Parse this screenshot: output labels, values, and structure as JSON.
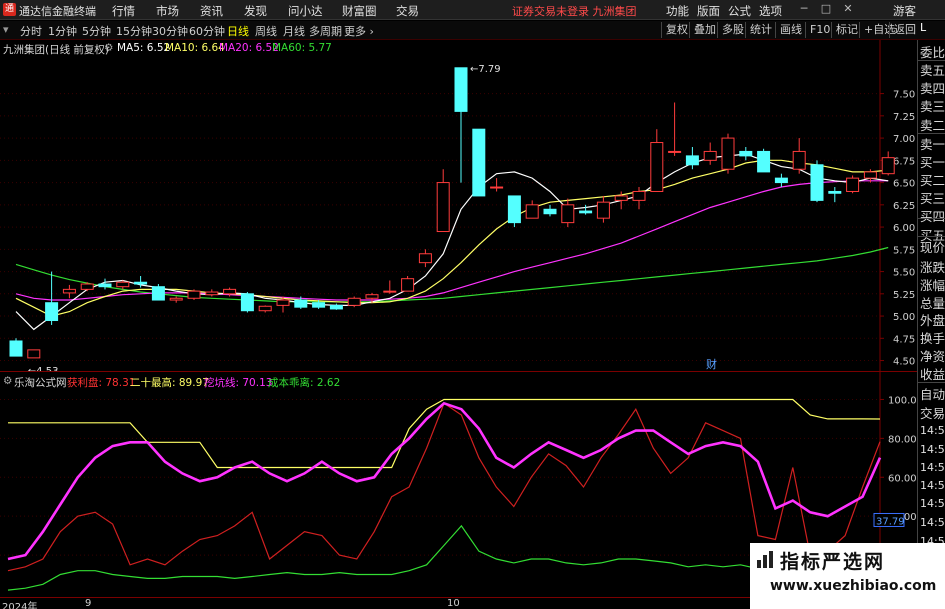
{
  "app": {
    "title": "通达信金融终端",
    "logo_letter": "通",
    "menus": [
      "行情",
      "市场",
      "资讯",
      "发现",
      "问小达",
      "财富圈",
      "交易"
    ],
    "status": "证券交易未登录  九洲集团",
    "right_menus": [
      "功能",
      "版面",
      "公式",
      "选项"
    ],
    "guest": "游客"
  },
  "toolbar": {
    "timeframes": [
      "分时",
      "1分钟",
      "5分钟",
      "15分钟",
      "30分钟",
      "60分钟",
      "日线",
      "周线",
      "月线",
      "多周期",
      "更多"
    ],
    "active_timeframe": "日线",
    "buttons": [
      "复权",
      "叠加",
      "多股",
      "统计",
      "画线",
      "F10",
      "标记",
      "+自选",
      "返回"
    ]
  },
  "main_chart": {
    "title": "九洲集团(日线 前复权)",
    "ma_labels": [
      {
        "text": "MA5: 6.52",
        "color": "#ffffff"
      },
      {
        "text": "MA10: 6.64",
        "color": "#ffff66"
      },
      {
        "text": "MA20: 6.52",
        "color": "#ff33ff"
      },
      {
        "text": "MA60: 5.77",
        "color": "#33dd33"
      }
    ],
    "high_label": "7.79",
    "low_label": "4.53",
    "marker": "财",
    "price_ticks": [
      "7.50",
      "7.25",
      "7.00",
      "6.75",
      "6.50",
      "6.25",
      "6.00",
      "5.75",
      "5.50",
      "5.25",
      "5.00",
      "4.75",
      "4.50"
    ]
  },
  "sub_chart": {
    "title": "乐淘公式网",
    "labels": [
      {
        "text": "获利盘: 78.31",
        "color": "#ff3333"
      },
      {
        "text": "二十最高: 89.97",
        "color": "#ffff66"
      },
      {
        "text": "挖坑线: 70.13",
        "color": "#ff33ff"
      },
      {
        "text": "成本乖离: 2.62",
        "color": "#33dd33"
      }
    ],
    "ticks": [
      "100.0",
      "80.00",
      "60.00",
      "40.00",
      "20.00"
    ],
    "current_value": "37.79"
  },
  "xaxis": {
    "labels": [
      "2024年",
      "9",
      "10"
    ]
  },
  "side_panel": {
    "items": [
      "委比",
      "卖五",
      "卖四",
      "卖三",
      "卖二",
      "卖一",
      "买一",
      "买二",
      "买三",
      "买四",
      "买五",
      "现价",
      "涨跌",
      "涨幅",
      "总量",
      "外盘",
      "换手",
      "净资",
      "收益",
      "自动",
      "交易",
      "14:56",
      "14:56",
      "14:56",
      "14:56",
      "14:56",
      "14:56",
      "14:56",
      "14:56"
    ],
    "top_letter": "L"
  },
  "watermark": {
    "title": "指标严选网",
    "url": "www.xuezhibiao.com"
  },
  "chart_data": {
    "type": "candlestick",
    "price_range": [
      4.45,
      7.9
    ],
    "candles": [
      {
        "o": 4.72,
        "h": 4.75,
        "l": 4.55,
        "c": 4.55
      },
      {
        "o": 4.53,
        "h": 4.62,
        "l": 4.53,
        "c": 4.62
      },
      {
        "o": 5.15,
        "h": 5.5,
        "l": 4.9,
        "c": 4.95
      },
      {
        "o": 5.26,
        "h": 5.35,
        "l": 5.2,
        "c": 5.3
      },
      {
        "o": 5.3,
        "h": 5.38,
        "l": 5.28,
        "c": 5.36
      },
      {
        "o": 5.36,
        "h": 5.42,
        "l": 5.3,
        "c": 5.33
      },
      {
        "o": 5.33,
        "h": 5.4,
        "l": 5.3,
        "c": 5.38
      },
      {
        "o": 5.38,
        "h": 5.45,
        "l": 5.32,
        "c": 5.36
      },
      {
        "o": 5.33,
        "h": 5.36,
        "l": 5.18,
        "c": 5.18
      },
      {
        "o": 5.18,
        "h": 5.22,
        "l": 5.15,
        "c": 5.2
      },
      {
        "o": 5.2,
        "h": 5.3,
        "l": 5.18,
        "c": 5.28
      },
      {
        "o": 5.24,
        "h": 5.3,
        "l": 5.22,
        "c": 5.27
      },
      {
        "o": 5.25,
        "h": 5.32,
        "l": 5.22,
        "c": 5.3
      },
      {
        "o": 5.25,
        "h": 5.27,
        "l": 5.04,
        "c": 5.06
      },
      {
        "o": 5.06,
        "h": 5.12,
        "l": 5.04,
        "c": 5.11
      },
      {
        "o": 5.12,
        "h": 5.22,
        "l": 5.04,
        "c": 5.18
      },
      {
        "o": 5.18,
        "h": 5.22,
        "l": 5.08,
        "c": 5.1
      },
      {
        "o": 5.15,
        "h": 5.18,
        "l": 5.08,
        "c": 5.1
      },
      {
        "o": 5.12,
        "h": 5.14,
        "l": 5.07,
        "c": 5.08
      },
      {
        "o": 5.12,
        "h": 5.22,
        "l": 5.1,
        "c": 5.2
      },
      {
        "o": 5.2,
        "h": 5.26,
        "l": 5.15,
        "c": 5.24
      },
      {
        "o": 5.28,
        "h": 5.4,
        "l": 5.25,
        "c": 5.28
      },
      {
        "o": 5.28,
        "h": 5.45,
        "l": 5.28,
        "c": 5.42
      },
      {
        "o": 5.6,
        "h": 5.75,
        "l": 5.55,
        "c": 5.7
      },
      {
        "o": 5.95,
        "h": 6.65,
        "l": 5.95,
        "c": 6.5
      },
      {
        "o": 7.79,
        "h": 7.79,
        "l": 6.5,
        "c": 7.3
      },
      {
        "o": 7.1,
        "h": 7.1,
        "l": 6.35,
        "c": 6.35
      },
      {
        "o": 6.45,
        "h": 6.55,
        "l": 6.4,
        "c": 6.45
      },
      {
        "o": 6.35,
        "h": 6.35,
        "l": 6.0,
        "c": 6.05
      },
      {
        "o": 6.1,
        "h": 6.3,
        "l": 6.1,
        "c": 6.25
      },
      {
        "o": 6.2,
        "h": 6.25,
        "l": 6.12,
        "c": 6.15
      },
      {
        "o": 6.05,
        "h": 6.32,
        "l": 6.0,
        "c": 6.25
      },
      {
        "o": 6.18,
        "h": 6.25,
        "l": 6.14,
        "c": 6.16
      },
      {
        "o": 6.1,
        "h": 6.35,
        "l": 6.05,
        "c": 6.28
      },
      {
        "o": 6.3,
        "h": 6.4,
        "l": 6.2,
        "c": 6.35
      },
      {
        "o": 6.3,
        "h": 6.45,
        "l": 6.2,
        "c": 6.4
      },
      {
        "o": 6.4,
        "h": 7.1,
        "l": 6.4,
        "c": 6.95
      },
      {
        "o": 6.85,
        "h": 7.4,
        "l": 6.8,
        "c": 6.85
      },
      {
        "o": 6.8,
        "h": 6.9,
        "l": 6.65,
        "c": 6.7
      },
      {
        "o": 6.75,
        "h": 6.95,
        "l": 6.7,
        "c": 6.85
      },
      {
        "o": 6.65,
        "h": 7.05,
        "l": 6.6,
        "c": 7.0
      },
      {
        "o": 6.85,
        "h": 6.9,
        "l": 6.75,
        "c": 6.8
      },
      {
        "o": 6.85,
        "h": 6.88,
        "l": 6.62,
        "c": 6.62
      },
      {
        "o": 6.55,
        "h": 6.6,
        "l": 6.45,
        "c": 6.5
      },
      {
        "o": 6.65,
        "h": 7.0,
        "l": 6.6,
        "c": 6.85
      },
      {
        "o": 6.7,
        "h": 6.75,
        "l": 6.28,
        "c": 6.3
      },
      {
        "o": 6.4,
        "h": 6.45,
        "l": 6.28,
        "c": 6.38
      },
      {
        "o": 6.4,
        "h": 6.58,
        "l": 6.38,
        "c": 6.55
      },
      {
        "o": 6.55,
        "h": 6.65,
        "l": 6.5,
        "c": 6.62
      },
      {
        "o": 6.6,
        "h": 6.85,
        "l": 6.58,
        "c": 6.78
      }
    ],
    "ma5": [
      5.05,
      4.85,
      5.0,
      5.15,
      5.3,
      5.38,
      5.4,
      5.35,
      5.32,
      5.28,
      5.25,
      5.24,
      5.26,
      5.25,
      5.2,
      5.18,
      5.15,
      5.13,
      5.12,
      5.12,
      5.16,
      5.2,
      5.3,
      5.45,
      5.7,
      6.2,
      6.45,
      6.6,
      6.62,
      6.55,
      6.4,
      6.2,
      6.22,
      6.25,
      6.3,
      6.35,
      6.5,
      6.62,
      6.72,
      6.78,
      6.8,
      6.82,
      6.75,
      6.68,
      6.65,
      6.55,
      6.52,
      6.5,
      6.55,
      6.52
    ],
    "ma10": [
      5.2,
      5.1,
      5.0,
      5.05,
      5.15,
      5.22,
      5.28,
      5.3,
      5.3,
      5.3,
      5.28,
      5.26,
      5.25,
      5.24,
      5.22,
      5.2,
      5.18,
      5.17,
      5.16,
      5.15,
      5.15,
      5.16,
      5.2,
      5.28,
      5.42,
      5.6,
      5.8,
      5.98,
      6.12,
      6.22,
      6.28,
      6.3,
      6.32,
      6.34,
      6.36,
      6.4,
      6.42,
      6.48,
      6.55,
      6.6,
      6.65,
      6.72,
      6.75,
      6.75,
      6.72,
      6.7,
      6.66,
      6.62,
      6.62,
      6.64
    ],
    "ma20": [
      5.25,
      5.2,
      5.18,
      5.18,
      5.2,
      5.22,
      5.24,
      5.25,
      5.26,
      5.26,
      5.26,
      5.25,
      5.24,
      5.23,
      5.22,
      5.21,
      5.2,
      5.19,
      5.18,
      5.18,
      5.18,
      5.19,
      5.2,
      5.22,
      5.26,
      5.32,
      5.38,
      5.44,
      5.5,
      5.55,
      5.6,
      5.65,
      5.7,
      5.76,
      5.82,
      5.9,
      5.98,
      6.06,
      6.14,
      6.22,
      6.28,
      6.34,
      6.4,
      6.45,
      6.48,
      6.5,
      6.51,
      6.52,
      6.52,
      6.52
    ],
    "ma60": [
      5.58,
      5.52,
      5.46,
      5.41,
      5.37,
      5.33,
      5.3,
      5.27,
      5.25,
      5.23,
      5.21,
      5.2,
      5.19,
      5.18,
      5.17,
      5.16,
      5.16,
      5.16,
      5.16,
      5.16,
      5.16,
      5.17,
      5.18,
      5.19,
      5.2,
      5.22,
      5.24,
      5.26,
      5.28,
      5.3,
      5.32,
      5.34,
      5.36,
      5.38,
      5.4,
      5.42,
      5.44,
      5.46,
      5.48,
      5.5,
      5.52,
      5.54,
      5.56,
      5.58,
      5.6,
      5.62,
      5.65,
      5.68,
      5.72,
      5.77
    ],
    "sub_range": [
      0,
      110
    ],
    "profit": [
      12,
      14,
      18,
      32,
      40,
      42,
      36,
      15,
      18,
      15,
      22,
      28,
      30,
      35,
      42,
      18,
      25,
      32,
      30,
      20,
      18,
      32,
      50,
      55,
      75,
      98,
      92,
      70,
      55,
      45,
      60,
      72,
      66,
      55,
      70,
      82,
      95,
      75,
      62,
      70,
      88,
      84,
      80,
      30,
      28,
      65,
      20,
      22,
      30,
      55,
      78.31
    ],
    "high20": [
      88,
      88,
      88,
      88,
      88,
      88,
      88,
      88,
      78,
      78,
      78,
      78,
      65,
      65,
      65,
      65,
      65,
      65,
      65,
      65,
      65,
      65,
      65,
      85,
      95,
      100,
      100,
      100,
      100,
      100,
      100,
      100,
      100,
      100,
      100,
      100,
      100,
      100,
      100,
      100,
      100,
      100,
      100,
      100,
      100,
      100,
      92,
      90,
      90,
      90,
      89.97
    ],
    "pit": [
      18,
      20,
      32,
      46,
      60,
      70,
      76,
      78,
      78,
      68,
      62,
      58,
      60,
      65,
      68,
      62,
      58,
      62,
      68,
      62,
      58,
      60,
      72,
      80,
      90,
      98,
      95,
      85,
      70,
      65,
      72,
      78,
      74,
      70,
      74,
      80,
      84,
      84,
      78,
      72,
      76,
      78,
      76,
      68,
      44,
      48,
      42,
      40,
      45,
      50,
      70.13
    ],
    "cost_dev": [
      2,
      3,
      5,
      10,
      12,
      12,
      10,
      9,
      8,
      8,
      9,
      9,
      9,
      8,
      9,
      10,
      11,
      10,
      10,
      11,
      10,
      10,
      10,
      12,
      15,
      25,
      35,
      22,
      18,
      16,
      18,
      18,
      16,
      15,
      16,
      18,
      18,
      17,
      16,
      14,
      15,
      14,
      15,
      13,
      12,
      10,
      5,
      4,
      3,
      3,
      2.62
    ]
  }
}
